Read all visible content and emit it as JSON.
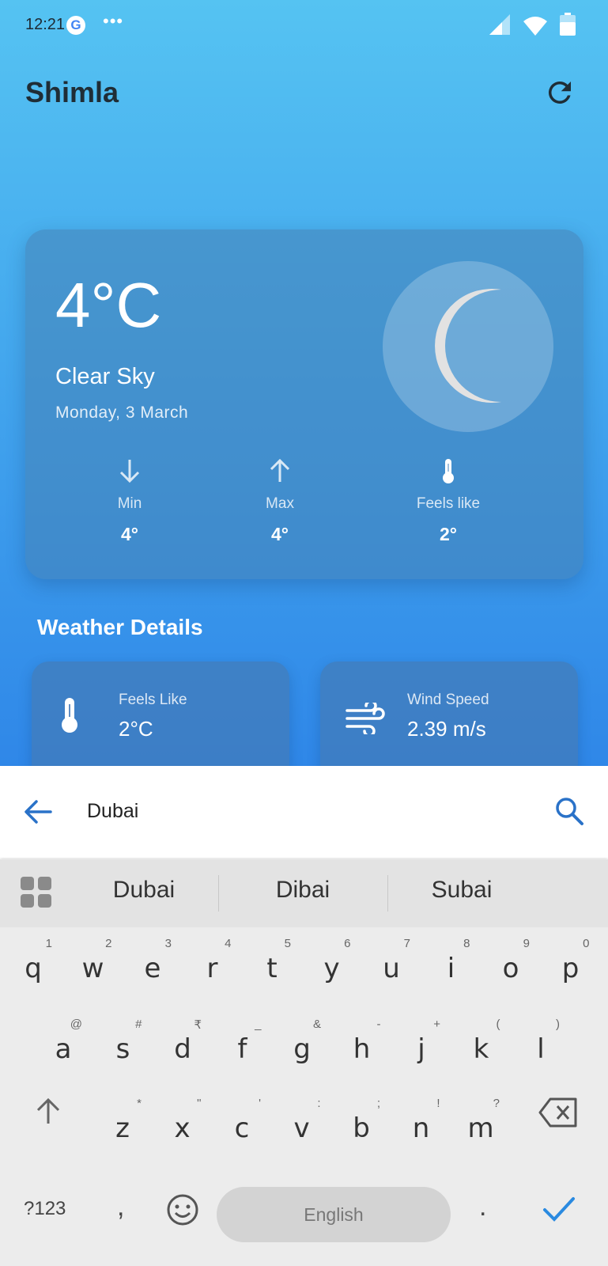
{
  "status_bar": {
    "time": "12:21",
    "google_glyph": "G",
    "more": "•••"
  },
  "header": {
    "city": "Shimla",
    "refresh_icon": "refresh-icon"
  },
  "current": {
    "temperature": "4°C",
    "condition": "Clear Sky",
    "date": "Monday, 3 March",
    "icon": "crescent-moon-icon",
    "stats": [
      {
        "label": "Min",
        "value": "4°",
        "icon": "arrow-down-icon"
      },
      {
        "label": "Max",
        "value": "4°",
        "icon": "arrow-up-icon"
      },
      {
        "label": "Feels like",
        "value": "2°",
        "icon": "thermometer-icon"
      }
    ]
  },
  "details": {
    "title": "Weather Details",
    "items": [
      {
        "label": "Feels Like",
        "value": "2°C",
        "icon": "thermometer-icon"
      },
      {
        "label": "Wind Speed",
        "value": "2.39 m/s",
        "icon": "wind-icon"
      }
    ]
  },
  "search": {
    "value": "Dubai",
    "back_icon": "arrow-left-icon",
    "search_icon": "search-icon"
  },
  "keyboard": {
    "suggestions": [
      "Dubai",
      "Dibai",
      "Subai"
    ],
    "row1": [
      {
        "k": "q",
        "h": "1"
      },
      {
        "k": "w",
        "h": "2"
      },
      {
        "k": "e",
        "h": "3"
      },
      {
        "k": "r",
        "h": "4"
      },
      {
        "k": "t",
        "h": "5"
      },
      {
        "k": "y",
        "h": "6"
      },
      {
        "k": "u",
        "h": "7"
      },
      {
        "k": "i",
        "h": "8"
      },
      {
        "k": "o",
        "h": "9"
      },
      {
        "k": "p",
        "h": "0"
      }
    ],
    "row2": [
      {
        "k": "a",
        "h": "@"
      },
      {
        "k": "s",
        "h": "#"
      },
      {
        "k": "d",
        "h": "₹"
      },
      {
        "k": "f",
        "h": "_"
      },
      {
        "k": "g",
        "h": "&"
      },
      {
        "k": "h",
        "h": "-"
      },
      {
        "k": "j",
        "h": "+"
      },
      {
        "k": "k",
        "h": "("
      },
      {
        "k": "l",
        "h": ")"
      }
    ],
    "row3": [
      {
        "k": "z",
        "h": "*"
      },
      {
        "k": "x",
        "h": "\""
      },
      {
        "k": "c",
        "h": "'"
      },
      {
        "k": "v",
        "h": ":"
      },
      {
        "k": "b",
        "h": ";"
      },
      {
        "k": "n",
        "h": "!"
      },
      {
        "k": "m",
        "h": "?"
      }
    ],
    "symbols": "?123",
    "comma": ",",
    "space": "English",
    "period": "."
  }
}
